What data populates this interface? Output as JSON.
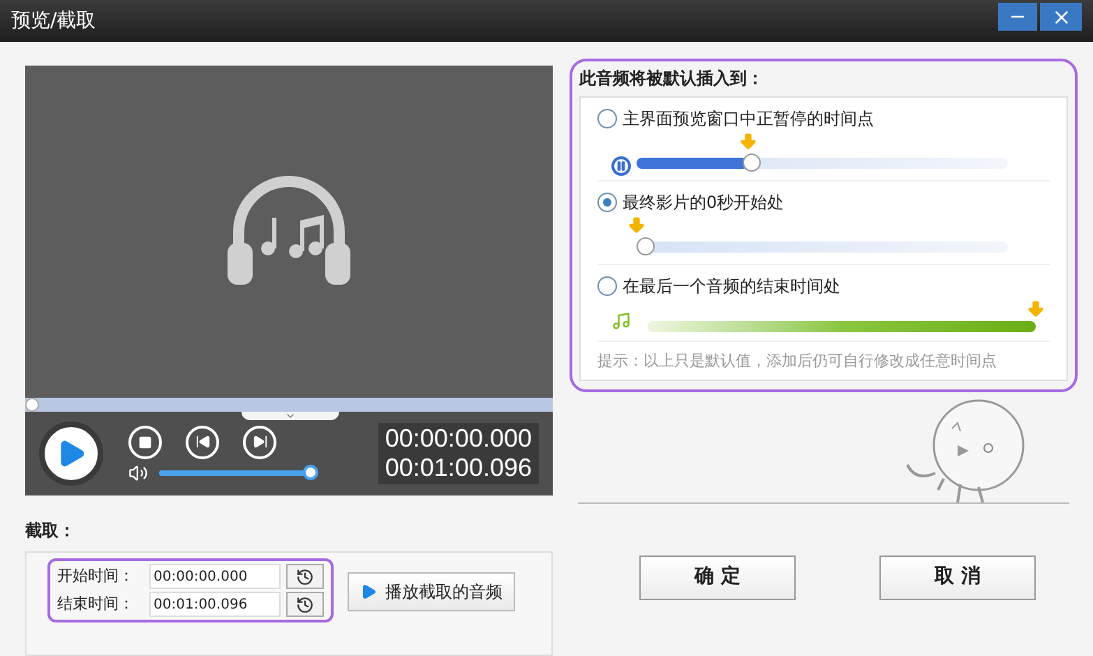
{
  "window": {
    "title": "预览/截取"
  },
  "player": {
    "progress": {
      "level": 0
    },
    "volume": {
      "level": 1
    },
    "time_current": "00:00:00.000",
    "time_total": "00:01:00.096"
  },
  "crop": {
    "title": "截取：",
    "fields": [
      {
        "label": "开始时间：",
        "value": "00:00:00.000"
      },
      {
        "label": "结束时间：",
        "value": "00:01:00.096"
      }
    ],
    "play_button": "播放截取的音频"
  },
  "insert_panel": {
    "title": "此音频将被默认插入到：",
    "options": [
      {
        "label": "主界面预览窗口中正暂停的时间点",
        "selected": false,
        "kind": "pause",
        "level": 0.3
      },
      {
        "label": "最终影片的0秒开始处",
        "selected": true,
        "kind": "plain",
        "level": 0
      },
      {
        "label": "在最后一个音频的结束时间处",
        "selected": false,
        "kind": "music",
        "level": 1
      }
    ],
    "hint": "提示：以上只是默认值，添加后仍可自行修改成任意时间点"
  },
  "buttons": [
    "确 定",
    "取 消"
  ]
}
